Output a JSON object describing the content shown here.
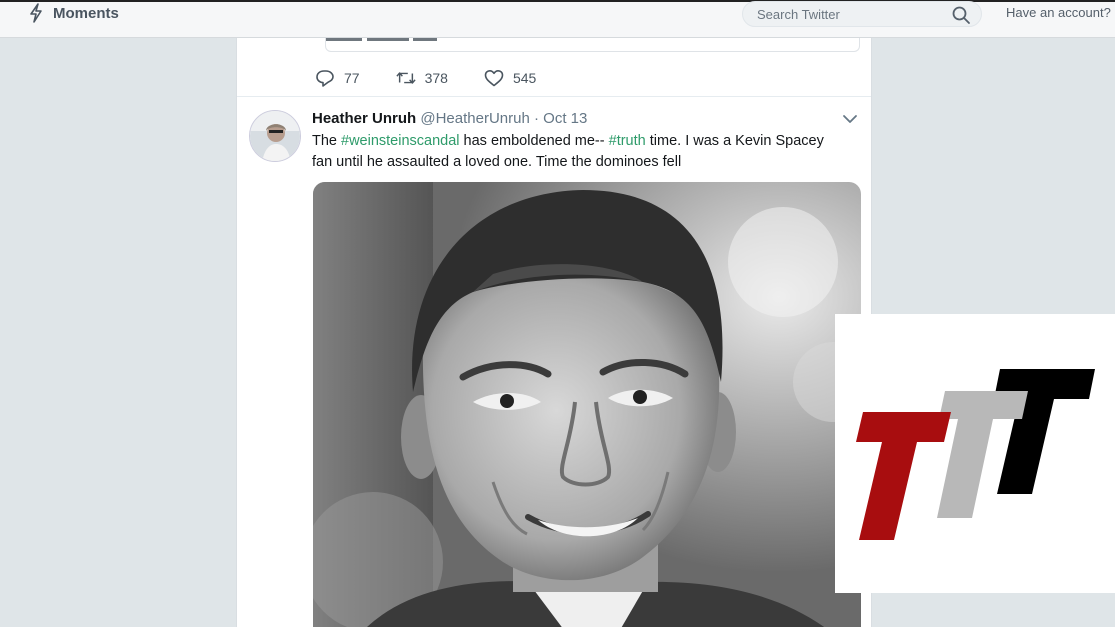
{
  "topbar": {
    "moments_label": "Moments",
    "search_placeholder": "Search Twitter",
    "have_account_text": "Have an account? L"
  },
  "previous_tweet": {
    "replies": "77",
    "retweets": "378",
    "likes": "545"
  },
  "tweet": {
    "author_name": "Heather Unruh",
    "author_handle": "@HeatherUnruh",
    "separator": "·",
    "date": "Oct 13",
    "text_parts": [
      "The ",
      "#weinsteinscandal",
      " has emboldened me-- ",
      "#truth",
      " time.  I was a Kevin Spacey fan until he assaulted a loved one.  Time the dominoes fell"
    ]
  },
  "icons": {
    "moments": "lightning-bolt-icon",
    "search": "search-icon",
    "reply": "reply-icon",
    "retweet": "retweet-icon",
    "like": "heart-icon",
    "caret": "chevron-down-icon"
  },
  "colors": {
    "page_bg": "#dfe5e8",
    "hashtag": "#2e9b6a",
    "logo_red": "#a80d0f",
    "logo_gray": "#b8b8b8",
    "logo_black": "#000000"
  }
}
